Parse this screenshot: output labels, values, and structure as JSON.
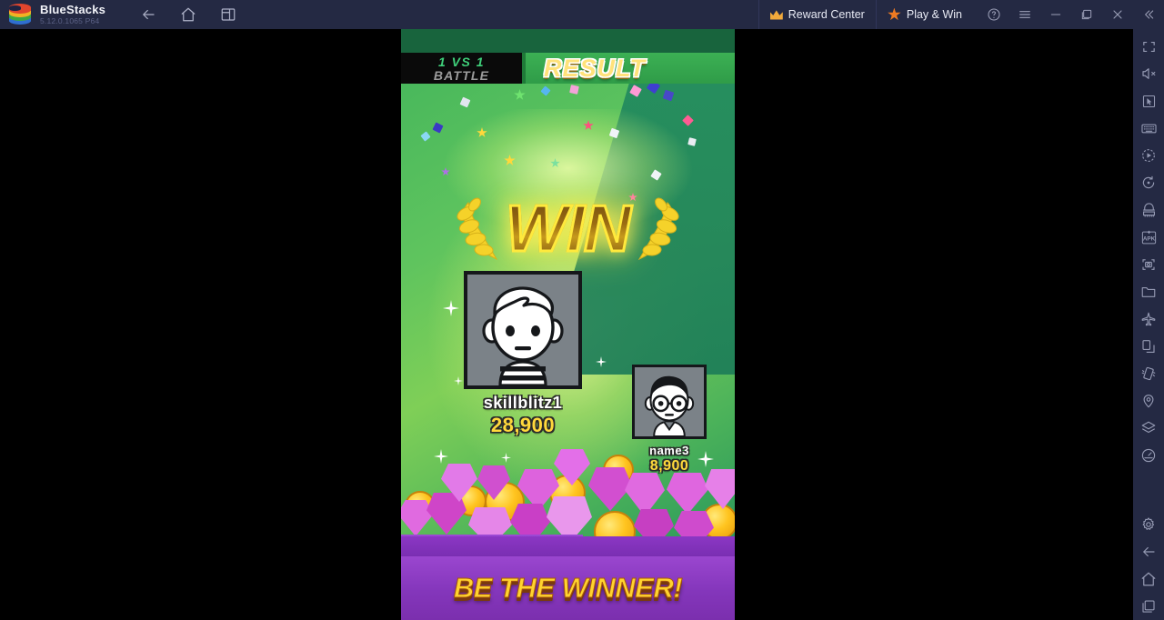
{
  "titlebar": {
    "brand_name": "BlueStacks",
    "version": "5.12.0.1065 P64",
    "nav": [
      {
        "name": "back-icon",
        "label": "Back"
      },
      {
        "name": "home-icon",
        "label": "Home"
      },
      {
        "name": "instance-manager-icon",
        "label": "Instance Manager"
      }
    ],
    "reward_center": "Reward Center",
    "play_and_win": "Play & Win",
    "window_controls": [
      {
        "name": "help-icon",
        "label": "Help"
      },
      {
        "name": "menu-icon",
        "label": "Menu"
      },
      {
        "name": "minimize-icon",
        "label": "Minimize"
      },
      {
        "name": "maximize-icon",
        "label": "Maximize"
      },
      {
        "name": "close-icon",
        "label": "Close"
      },
      {
        "name": "collapse-icon",
        "label": "Collapse"
      }
    ]
  },
  "sidebar": {
    "items": [
      {
        "name": "fullscreen-icon",
        "label": "Fullscreen"
      },
      {
        "name": "mute-icon",
        "label": "Mute"
      },
      {
        "name": "cursor-icon",
        "label": "Cursor Control"
      },
      {
        "name": "keyboard-icon",
        "label": "Game Controls"
      },
      {
        "name": "macro-record-icon",
        "label": "Macro Recorder"
      },
      {
        "name": "rotate-icon",
        "label": "Rotate"
      },
      {
        "name": "multi-instance-icon",
        "label": "Multi Instance"
      },
      {
        "name": "install-apk-icon",
        "label": "Install APK"
      },
      {
        "name": "screenshot-icon",
        "label": "Screenshot"
      },
      {
        "name": "media-manager-icon",
        "label": "Media Manager"
      },
      {
        "name": "airplane-mode-icon",
        "label": "Airplane Mode"
      },
      {
        "name": "copy-paste-icon",
        "label": "Copy to Clipboard"
      },
      {
        "name": "shake-icon",
        "label": "Shake"
      },
      {
        "name": "location-icon",
        "label": "Location"
      },
      {
        "name": "layers-icon",
        "label": "Eco Mode"
      },
      {
        "name": "performance-icon",
        "label": "Performance Monitor"
      },
      {
        "name": "settings-icon",
        "label": "Settings"
      },
      {
        "name": "android-back-icon",
        "label": "Back"
      },
      {
        "name": "android-home-icon",
        "label": "Home"
      },
      {
        "name": "android-recents-icon",
        "label": "Recent Apps"
      }
    ]
  },
  "game": {
    "header": {
      "battle_line1": "1 VS 1",
      "battle_line2": "BATTLE",
      "result": "RESULT"
    },
    "win_text": "WIN",
    "players": [
      {
        "name": "skillblitz1",
        "score": "28,900",
        "avatar": "winner-avatar"
      },
      {
        "name": "name3",
        "score": "8,900",
        "avatar": "loser-avatar"
      }
    ],
    "banner_text": "BE THE WINNER!"
  },
  "colors": {
    "titlebar_bg": "#242943",
    "accent_orange": "#ee7a22",
    "accent_gold": "#f2a93b",
    "game_green": "#4bb25a",
    "banner_purple": "#8436bb",
    "score_yellow": "#ffd83b",
    "gem_magenta": "#d94fd0",
    "coin_gold": "#ffc41f"
  }
}
